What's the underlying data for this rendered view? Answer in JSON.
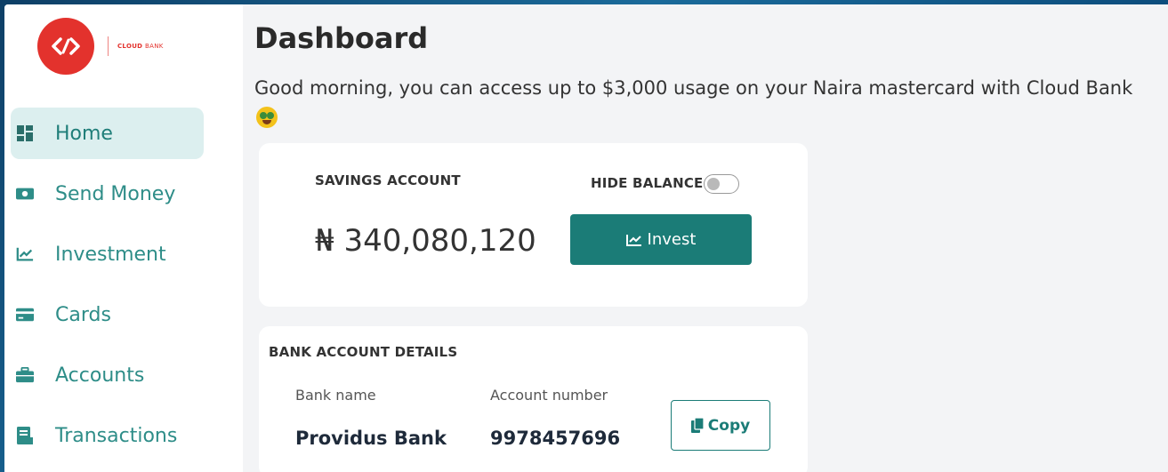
{
  "brand": {
    "name_bold": "CLOUD",
    "name_light": "BANK",
    "color": "#e3322d",
    "icon": "cloud-bank-logo-icon"
  },
  "sidebar": {
    "items": [
      {
        "label": "Home",
        "icon": "dashboard-icon",
        "active": true
      },
      {
        "label": "Send Money",
        "icon": "money-icon",
        "active": false
      },
      {
        "label": "Investment",
        "icon": "chart-line-icon",
        "active": false
      },
      {
        "label": "Cards",
        "icon": "credit-card-icon",
        "active": false
      },
      {
        "label": "Accounts",
        "icon": "briefcase-icon",
        "active": false
      },
      {
        "label": "Transactions",
        "icon": "receipt-icon",
        "active": false
      }
    ]
  },
  "main": {
    "title": "Dashboard",
    "greeting": "Good morning, you can access up to $3,000 usage on your Naira mastercard with Cloud Bank",
    "emoji": "money-mouth-face-icon"
  },
  "savings": {
    "label": "SAVINGS ACCOUNT",
    "hide_balance_label": "HIDE BALANCE",
    "hide_balance_on": false,
    "balance": "₦ 340,080,120",
    "invest_label": "Invest"
  },
  "bank_details": {
    "title": "BANK ACCOUNT DETAILS",
    "bank_name_label": "Bank name",
    "bank_name": "Providus Bank",
    "account_number_label": "Account number",
    "account_number": "9978457696",
    "copy_label": "Copy"
  },
  "colors": {
    "accent": "#1b7c77",
    "nav_active_bg": "#dcefef",
    "nav_text": "#2e8d88"
  }
}
